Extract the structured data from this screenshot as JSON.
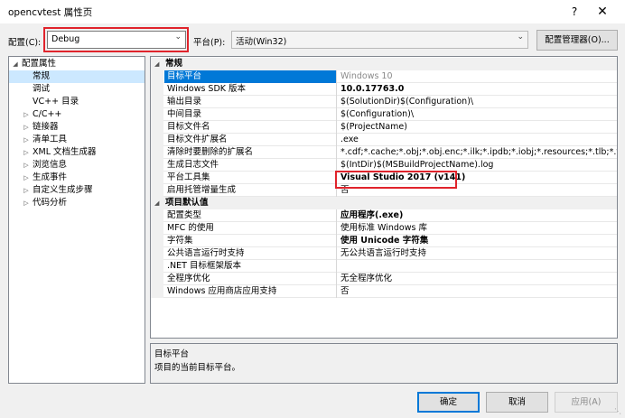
{
  "window": {
    "title": "opencvtest 属性页",
    "help": "?",
    "close": "✕"
  },
  "toolbar": {
    "config_label": "配置(C):",
    "config_value": "Debug",
    "platform_label": "平台(P):",
    "platform_value": "活动(Win32)",
    "config_manager": "配置管理器(O)..."
  },
  "tree": {
    "items": [
      {
        "label": "配置属性",
        "expanded": true
      },
      {
        "label": "常规",
        "selected": true
      },
      {
        "label": "调试"
      },
      {
        "label": "VC++ 目录"
      },
      {
        "label": "C/C++",
        "expandable": true
      },
      {
        "label": "链接器",
        "expandable": true
      },
      {
        "label": "清单工具",
        "expandable": true
      },
      {
        "label": "XML 文档生成器",
        "expandable": true
      },
      {
        "label": "浏览信息",
        "expandable": true
      },
      {
        "label": "生成事件",
        "expandable": true
      },
      {
        "label": "自定义生成步骤",
        "expandable": true
      },
      {
        "label": "代码分析",
        "expandable": true
      }
    ]
  },
  "grid": {
    "categories": [
      {
        "label": "常规",
        "props": [
          {
            "name": "目标平台",
            "value": "Windows 10",
            "selected": true,
            "disabled": true
          },
          {
            "name": "Windows SDK 版本",
            "value": "10.0.17763.0",
            "bold": true
          },
          {
            "name": "输出目录",
            "value": "$(SolutionDir)$(Configuration)\\"
          },
          {
            "name": "中间目录",
            "value": "$(Configuration)\\"
          },
          {
            "name": "目标文件名",
            "value": "$(ProjectName)"
          },
          {
            "name": "目标文件扩展名",
            "value": ".exe"
          },
          {
            "name": "清除时要删除的扩展名",
            "value": "*.cdf;*.cache;*.obj;*.obj.enc;*.ilk;*.ipdb;*.iobj;*.resources;*.tlb;*.tli;*.t"
          },
          {
            "name": "生成日志文件",
            "value": "$(IntDir)$(MSBuildProjectName).log"
          },
          {
            "name": "平台工具集",
            "value": "Visual Studio 2017 (v141)",
            "bold": true
          },
          {
            "name": "启用托管增量生成",
            "value": "否"
          }
        ]
      },
      {
        "label": "项目默认值",
        "props": [
          {
            "name": "配置类型",
            "value": "应用程序(.exe)",
            "bold": true
          },
          {
            "name": "MFC 的使用",
            "value": "使用标准 Windows 库"
          },
          {
            "name": "字符集",
            "value": "使用 Unicode 字符集",
            "bold": true
          },
          {
            "name": "公共语言运行时支持",
            "value": "无公共语言运行时支持"
          },
          {
            "name": ".NET 目标框架版本",
            "value": ""
          },
          {
            "name": "全程序优化",
            "value": "无全程序优化"
          },
          {
            "name": "Windows 应用商店应用支持",
            "value": "否"
          }
        ]
      }
    ]
  },
  "description": {
    "title": "目标平台",
    "text": "项目的当前目标平台。"
  },
  "buttons": {
    "ok": "确定",
    "cancel": "取消",
    "apply": "应用(A)"
  },
  "colors": {
    "selection": "#0078d7",
    "highlight_box": "#e0242c",
    "tree_selection": "#cce8ff"
  }
}
